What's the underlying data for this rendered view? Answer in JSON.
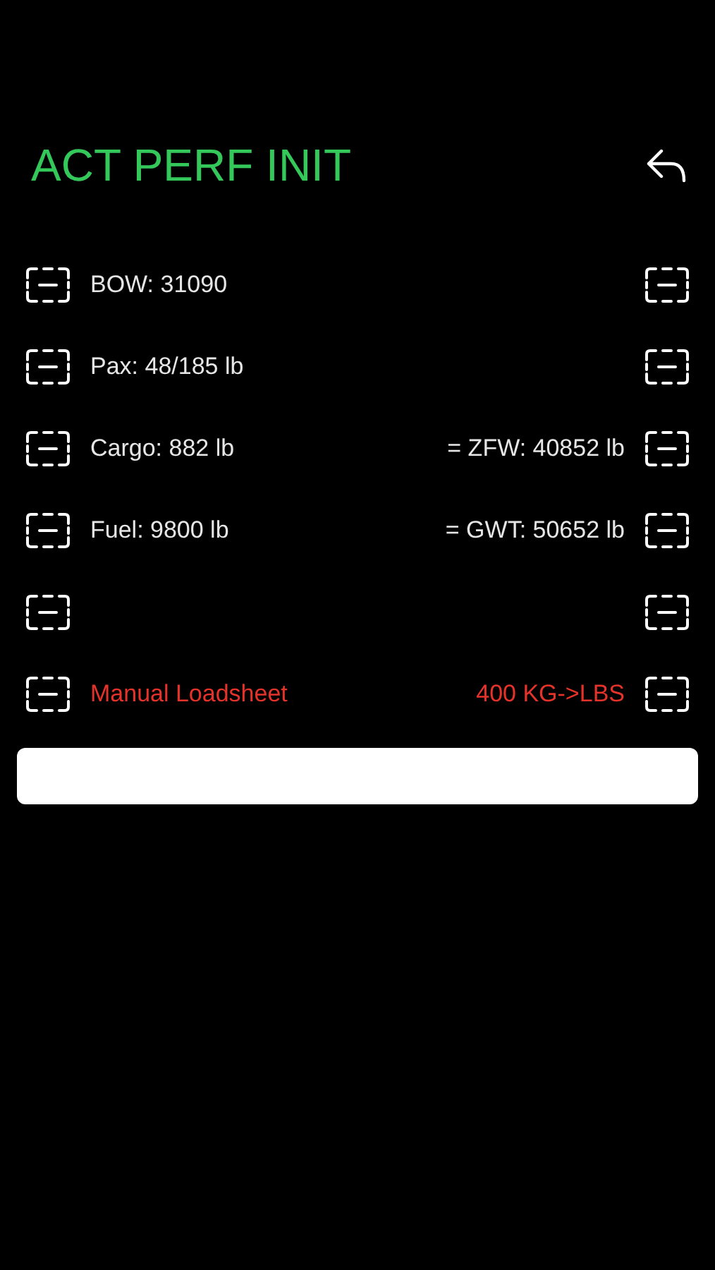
{
  "title": "ACT PERF INIT",
  "rows": [
    {
      "kind": "normal",
      "left": "BOW: 31090"
    },
    {
      "kind": "normal",
      "left": "Pax: 48/185 lb"
    },
    {
      "kind": "normal",
      "left": "Cargo: 882 lb",
      "right": "= ZFW: 40852 lb"
    },
    {
      "kind": "normal",
      "left": "Fuel: 9800 lb",
      "right": "= GWT: 50652 lb"
    },
    {},
    {
      "kind": "alert",
      "left": "Manual Loadsheet",
      "right": "400 KG->LBS"
    }
  ]
}
